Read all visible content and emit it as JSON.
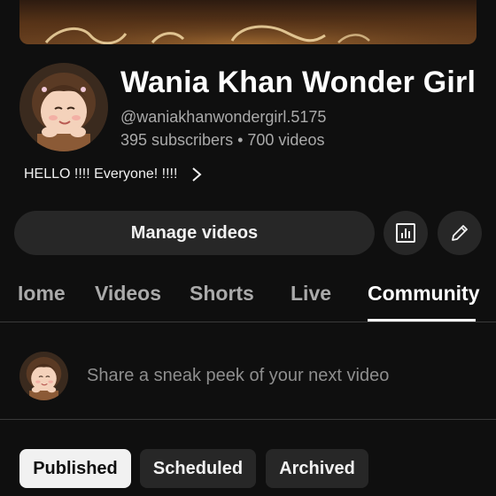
{
  "channel": {
    "name": "Wania Khan Wonder Girl",
    "handle": "@waniakhanwondergirl.5175",
    "subscribers": "395 subscribers",
    "separator": "•",
    "videos": "700 videos",
    "description": "HELLO !!!! Everyone! !!!!"
  },
  "actions": {
    "manage_label": "Manage videos",
    "analytics_icon": "analytics-icon",
    "edit_icon": "pencil-icon"
  },
  "tabs": [
    {
      "label": "Iome"
    },
    {
      "label": "Videos"
    },
    {
      "label": "Shorts"
    },
    {
      "label": "Live"
    },
    {
      "label": "Community",
      "active": true
    }
  ],
  "composer": {
    "placeholder": "Share a sneak peek of your next video"
  },
  "filters": [
    {
      "label": "Published",
      "selected": true
    },
    {
      "label": "Scheduled"
    },
    {
      "label": "Archived"
    }
  ],
  "colors": {
    "background": "#0f0f0f",
    "surface": "#272727",
    "text_primary": "#f1f1f1",
    "text_secondary": "#aaaaaa"
  }
}
